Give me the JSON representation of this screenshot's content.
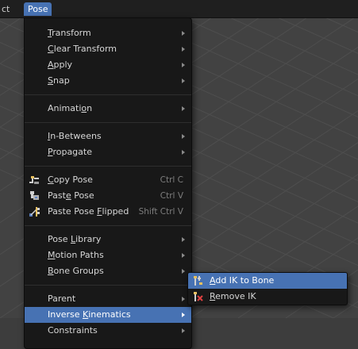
{
  "topbar": {
    "prev_menu": "ct",
    "active_menu": "Pose"
  },
  "pose_menu": {
    "items": [
      {
        "pre": "",
        "u": "T",
        "post": "ransform"
      },
      {
        "pre": "",
        "u": "C",
        "post": "lear Transform"
      },
      {
        "pre": "",
        "u": "A",
        "post": "pply"
      },
      {
        "pre": "",
        "u": "S",
        "post": "nap"
      },
      {
        "pre": "Animati",
        "u": "o",
        "post": "n"
      },
      {
        "pre": "",
        "u": "I",
        "post": "n-Betweens"
      },
      {
        "pre": "",
        "u": "P",
        "post": "ropagate"
      },
      {
        "pre": "",
        "u": "C",
        "post": "opy Pose",
        "shortcut": "Ctrl C"
      },
      {
        "pre": "Past",
        "u": "e",
        "post": " Pose",
        "shortcut": "Ctrl V"
      },
      {
        "pre": "Paste Pose ",
        "u": "F",
        "post": "lipped",
        "shortcut": "Shift Ctrl V"
      },
      {
        "pre": "Pose ",
        "u": "L",
        "post": "ibrary"
      },
      {
        "pre": "",
        "u": "M",
        "post": "otion Paths"
      },
      {
        "pre": "",
        "u": "B",
        "post": "one Groups"
      },
      {
        "pre": "Parent",
        "u": "",
        "post": ""
      },
      {
        "pre": "Inverse ",
        "u": "K",
        "post": "inematics"
      },
      {
        "pre": "Constraints",
        "u": "",
        "post": ""
      }
    ]
  },
  "ik_submenu": {
    "items": [
      {
        "pre": "",
        "u": "A",
        "post": "dd IK to Bone"
      },
      {
        "pre": "",
        "u": "R",
        "post": "emove IK"
      }
    ]
  },
  "icons": {
    "copy": "copy-pose-icon",
    "paste": "paste-pose-icon",
    "paste_flipped": "paste-flipped-icon",
    "add_ik": "add-ik-icon",
    "remove_ik": "remove-ik-icon"
  },
  "colors": {
    "accent": "#4772b3",
    "menu_bg": "#181818",
    "viewport_bg": "#424242"
  }
}
